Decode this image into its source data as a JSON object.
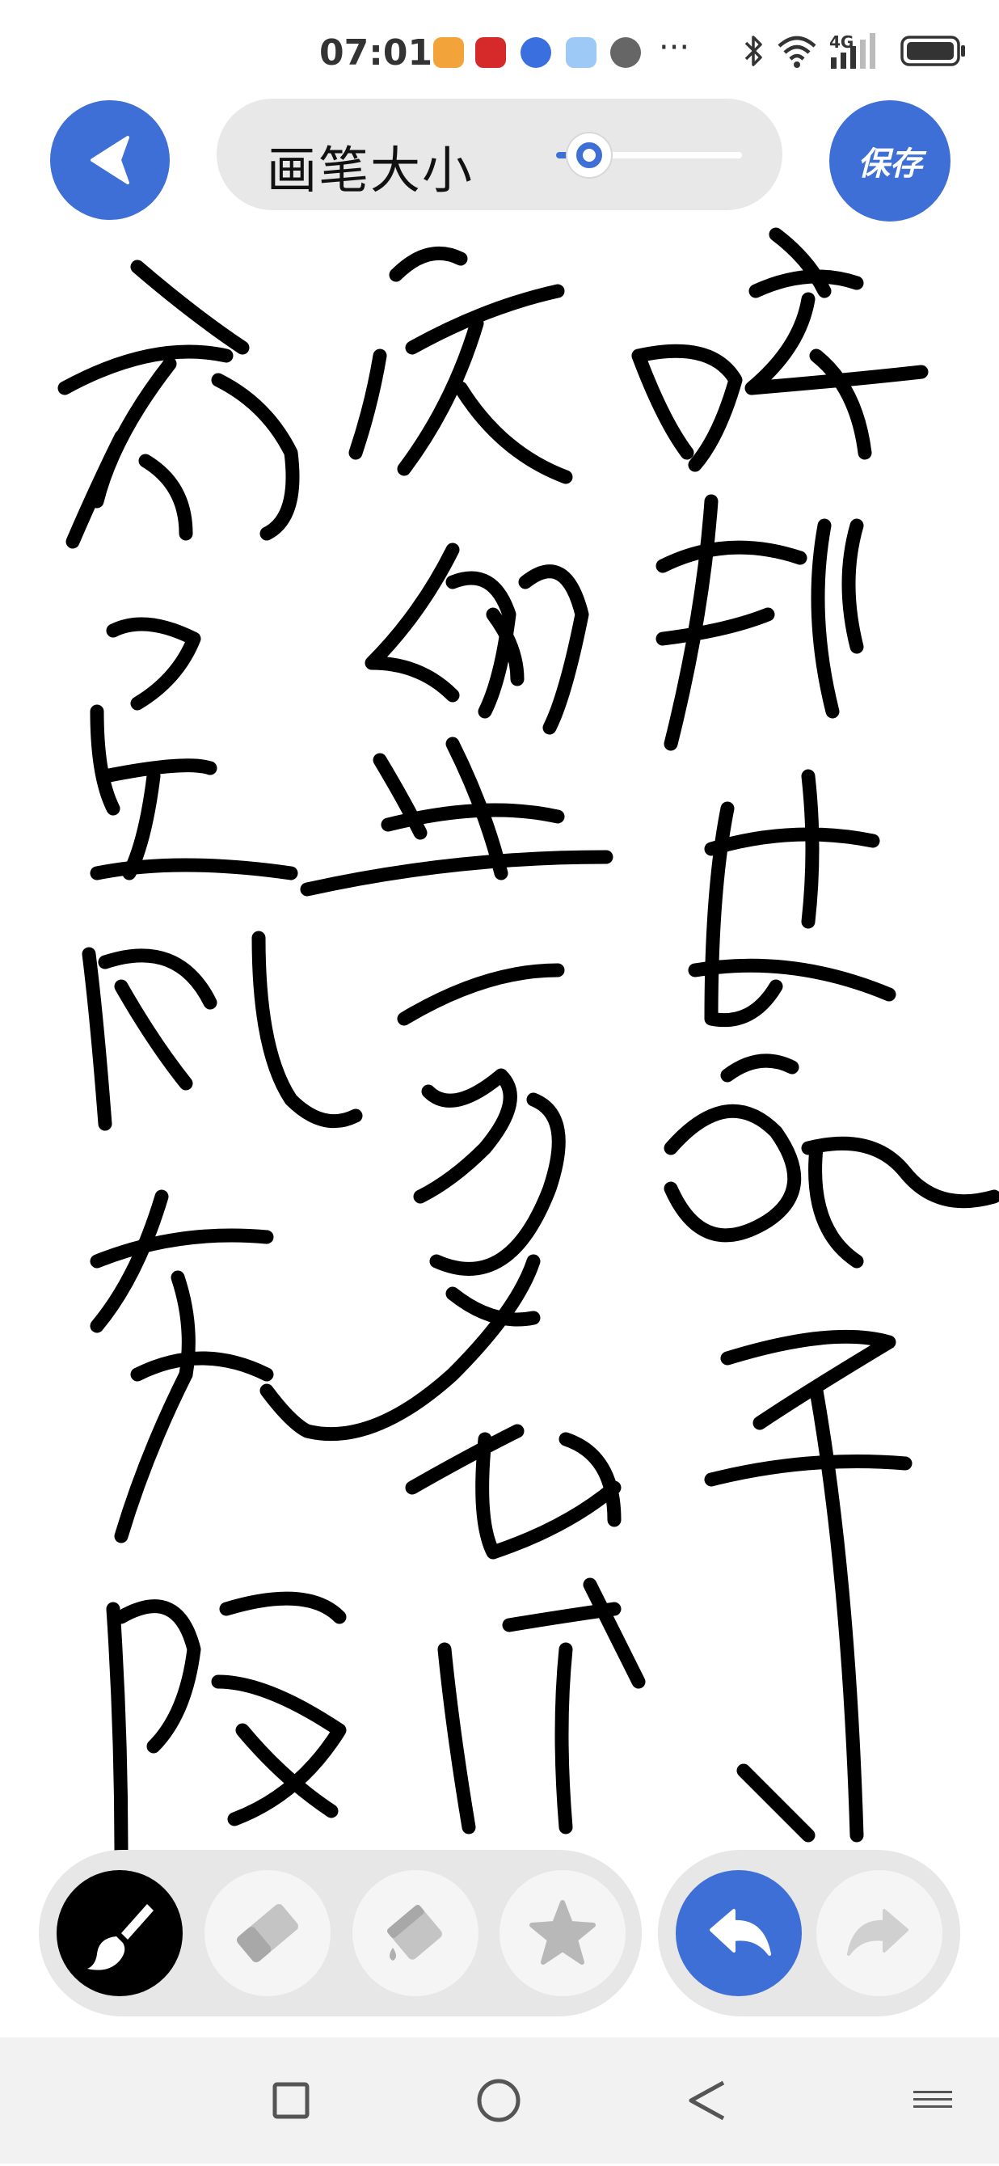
{
  "status_bar": {
    "time": "07:01",
    "network": "4G",
    "icons": [
      "bluetooth-icon",
      "wifi-icon",
      "signal-icon",
      "battery-icon"
    ]
  },
  "toolbar_top": {
    "brush_size_label": "画笔大小",
    "brush_size_fraction": 0.18,
    "save_label": "保存"
  },
  "tools": {
    "brush": "brush-icon",
    "eraser": "eraser-icon",
    "fill": "paint-bucket-icon",
    "sticker": "star-icon",
    "undo": "undo-icon",
    "redo": "redo-icon"
  },
  "colors": {
    "accent": "#3e6fd6",
    "active_tool": "#000000",
    "inactive_tool": "#f5f5f5",
    "pill_bg": "#e7e7e7"
  },
  "nav_bar": {
    "items": [
      "recents-square-icon",
      "home-circle-icon",
      "back-triangle-icon"
    ]
  }
}
